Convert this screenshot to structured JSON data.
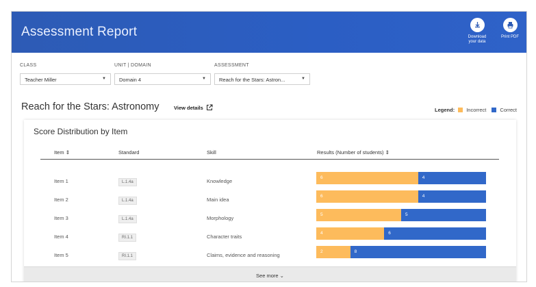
{
  "header": {
    "title": "Assessment Report",
    "download_label_line1": "Download",
    "download_label_line2": "your data",
    "print_label": "Print PDF"
  },
  "filters": {
    "class": {
      "label": "CLASS",
      "value": "Teacher Miller"
    },
    "unit": {
      "label": "UNIT | DOMAIN",
      "value": "Domain 4"
    },
    "assessment": {
      "label": "ASSESSMENT",
      "value": "Reach for the Stars: Astron..."
    }
  },
  "assessment_title": "Reach for the Stars: Astronomy",
  "view_details": "View details",
  "legend": {
    "label": "Legend:",
    "incorrect": "Incorrect",
    "correct": "Correct",
    "incorrect_color": "#fdbb5c",
    "correct_color": "#3168c9"
  },
  "card": {
    "title": "Score Distribution by Item",
    "columns": {
      "item": "Item",
      "standard": "Standard",
      "skill": "Skill",
      "results": "Results (Number of students)"
    },
    "rows": [
      {
        "item": "Item 1",
        "standard": "L.1.4a",
        "skill": "Knowledge",
        "incorrect": 6,
        "correct": 4
      },
      {
        "item": "Item 2",
        "standard": "L.1.4a",
        "skill": "Main idea",
        "incorrect": 6,
        "correct": 4
      },
      {
        "item": "Item 3",
        "standard": "L.1.4a",
        "skill": "Morphology",
        "incorrect": 5,
        "correct": 5
      },
      {
        "item": "Item 4",
        "standard": "RI.1.1",
        "skill": "Character traits",
        "incorrect": 4,
        "correct": 6
      },
      {
        "item": "Item 5",
        "standard": "RI.1.1",
        "skill": "Claims, evidence and reasoning",
        "incorrect": 2,
        "correct": 8
      }
    ],
    "see_more": "See more"
  }
}
